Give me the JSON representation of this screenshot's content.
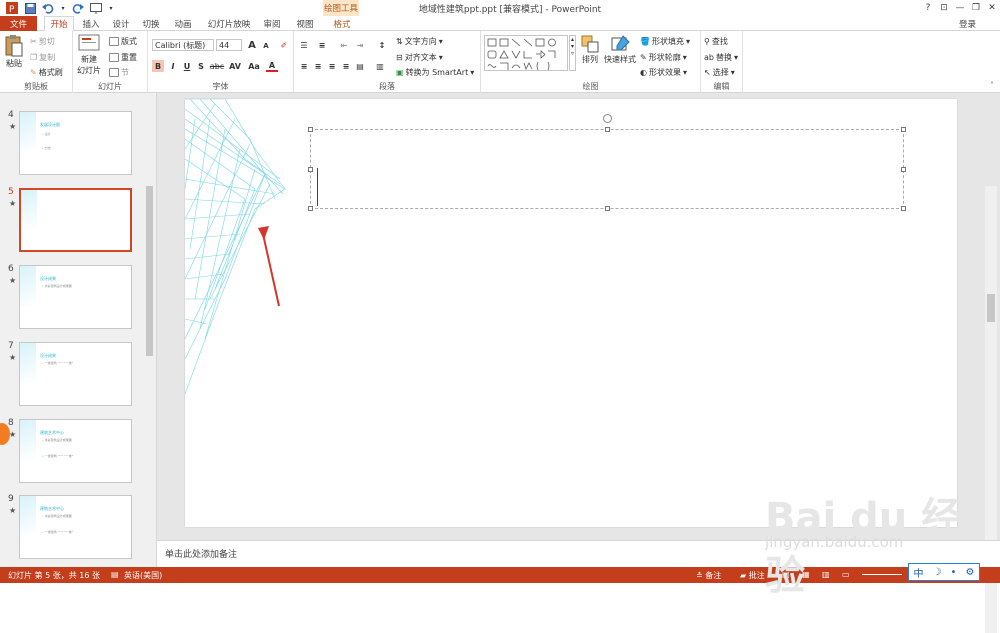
{
  "window": {
    "title": "地域性建筑ppt.ppt [兼容模式] - PowerPoint",
    "context_tab_group": "绘图工具",
    "help": "?",
    "minimize": "—",
    "restore": "❐",
    "close": "✕",
    "ribbon_toggle": "⊡"
  },
  "tabs": [
    {
      "label": "文件"
    },
    {
      "label": "开始"
    },
    {
      "label": "插入"
    },
    {
      "label": "设计"
    },
    {
      "label": "切换"
    },
    {
      "label": "动画"
    },
    {
      "label": "幻灯片放映"
    },
    {
      "label": "审阅"
    },
    {
      "label": "视图"
    },
    {
      "label": "格式"
    }
  ],
  "login": "登录",
  "clipboard": {
    "paste": "粘贴",
    "cut": "剪切",
    "copy": "复制",
    "format_painter": "格式刷",
    "label": "剪贴板"
  },
  "slides_group": {
    "new_slide_1": "新建",
    "new_slide_2": "幻灯片",
    "layout": "版式",
    "reset": "重置",
    "section": "节",
    "label": "幻灯片"
  },
  "font_group": {
    "font_name": "Calibri (标题)",
    "font_size": "44",
    "grow": "A",
    "shrink": "A",
    "bold": "B",
    "italic": "I",
    "underline": "U",
    "shadow": "S",
    "strike": "abc",
    "spacing": "AV",
    "case": "Aa",
    "color": "A",
    "label": "字体"
  },
  "paragraph_group": {
    "text_direction": "文字方向",
    "align_text": "对齐文本",
    "smartart": "转换为 SmartArt",
    "label": "段落"
  },
  "drawing_group": {
    "arrange": "排列",
    "quick_styles": "快速样式",
    "shape_fill": "形状填充",
    "shape_outline": "形状轮廓",
    "shape_effects": "形状效果",
    "label": "绘图"
  },
  "editing_group": {
    "find": "查找",
    "replace": "替换",
    "select": "选择",
    "label": "编辑"
  },
  "thumbnails": [
    {
      "num": "4",
      "title": "发展设计图",
      "lines": [
        "• 设计",
        "• 方式"
      ]
    },
    {
      "num": "5",
      "title": "",
      "lines": []
    },
    {
      "num": "6",
      "title": "设计成果",
      "lines": [
        "• 水彩建筑设计成果展"
      ]
    },
    {
      "num": "7",
      "title": "设计成果",
      "lines": [
        "• 一类建筑 \"一\" \"一类\""
      ]
    },
    {
      "num": "8",
      "title": "建筑艺术中心",
      "lines": [
        "• 水彩建筑设计成果展",
        "• 一类建筑 \"一\" \"一类\""
      ]
    },
    {
      "num": "9",
      "title": "建筑艺术中心",
      "lines": [
        "• 水彩建筑设计成果展",
        "• 一类建筑 \"一\" \"一类\""
      ]
    }
  ],
  "star": "★",
  "notes_placeholder": "单击此处添加备注",
  "status": {
    "slide_info": "幻灯片 第 5 张，共 16 张",
    "language": "英语(美国)",
    "notes": "备注",
    "comments": "批注"
  },
  "ime": {
    "lang": "中",
    "moon": "☽",
    "dot": "•",
    "gear": "⚙"
  },
  "watermark": {
    "brand": "Bai du 经验",
    "url": "jingyan.baidu.com"
  },
  "colors": {
    "accent": "#c43e1c",
    "format_tab": "#b2591d",
    "context_bg": "#fde6c8",
    "arrow": "#d9342b",
    "sketch": "#5fd0e0"
  }
}
